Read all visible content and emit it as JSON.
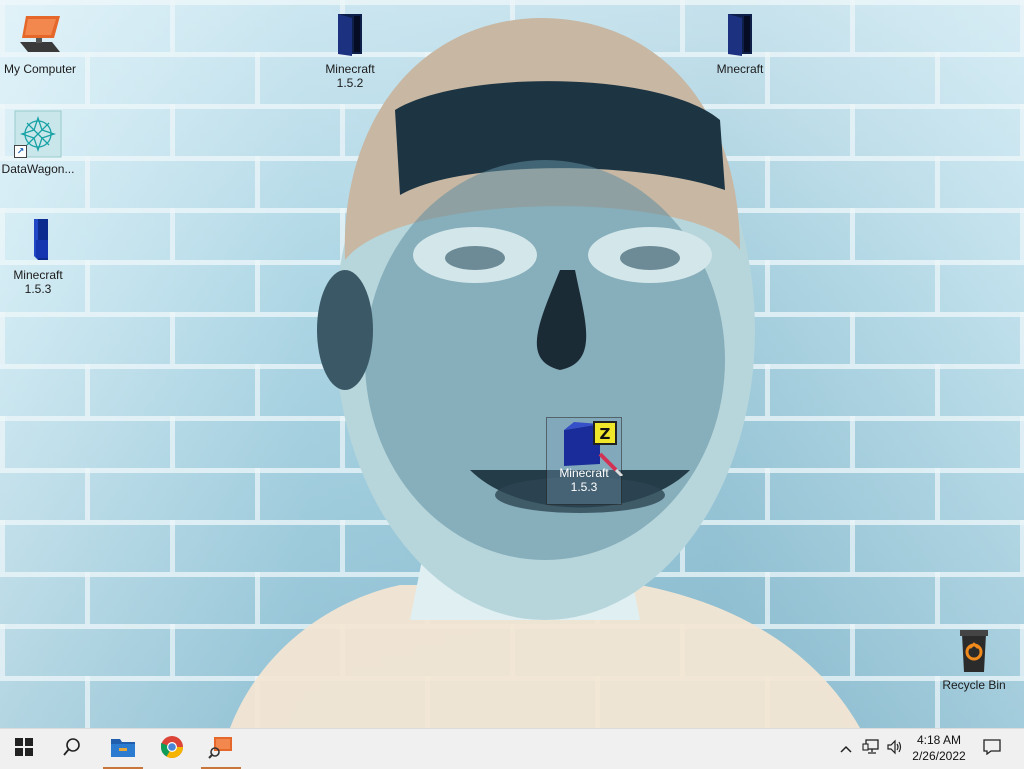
{
  "desktop": {
    "icons": [
      {
        "label": "My Computer",
        "icon": "computer-icon"
      },
      {
        "label": "DataWagon...",
        "icon": "datawagon-icon"
      },
      {
        "label": "Minecraft\n1.5.3",
        "icon": "folder-blue-icon"
      },
      {
        "label": "Minecraft\n1.5.2",
        "icon": "folder-dark-icon"
      },
      {
        "label": "Mnecraft",
        "icon": "folder-dark-icon"
      },
      {
        "label": "Minecraft\n1.5.3",
        "icon": "zip-archive-icon"
      },
      {
        "label": "Recycle Bin",
        "icon": "recycle-bin-icon"
      }
    ]
  },
  "taskbar": {
    "start_icon": "windows-start-icon",
    "search_icon": "search-icon",
    "pinned": [
      {
        "name": "file-explorer",
        "icon": "file-explorer-icon",
        "active": true
      },
      {
        "name": "chrome",
        "icon": "chrome-icon",
        "active": false
      },
      {
        "name": "computer-tool",
        "icon": "computer-search-icon",
        "active": true
      }
    ],
    "tray": {
      "chevron": "chevron-up-icon",
      "network": "network-icon",
      "volume": "volume-icon",
      "time": "4:18 AM",
      "date": "2/26/2022",
      "notifications": "notification-icon"
    }
  },
  "colors": {
    "taskbar_bg": "#f0f0f0",
    "taskbar_active": "#c8763c",
    "folder_blue": "#1a3aa8",
    "folder_dark": "#0e1f4a"
  }
}
